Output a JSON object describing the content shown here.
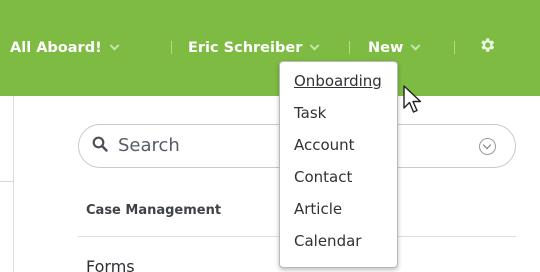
{
  "header": {
    "org_menu": "All Aboard!",
    "user_menu": "Eric Schreiber",
    "new_menu": "New",
    "settings_icon": "gear-icon",
    "bg_color": "#7dbb42"
  },
  "search": {
    "placeholder": "Search",
    "icon": "search-icon"
  },
  "content": {
    "section_label": "Case Management",
    "forms_label": "Forms"
  },
  "new_dropdown": {
    "items": [
      {
        "label": "Onboarding",
        "highlighted": true
      },
      {
        "label": "Task"
      },
      {
        "label": "Account"
      },
      {
        "label": "Contact"
      },
      {
        "label": "Article"
      },
      {
        "label": "Calendar"
      }
    ]
  }
}
